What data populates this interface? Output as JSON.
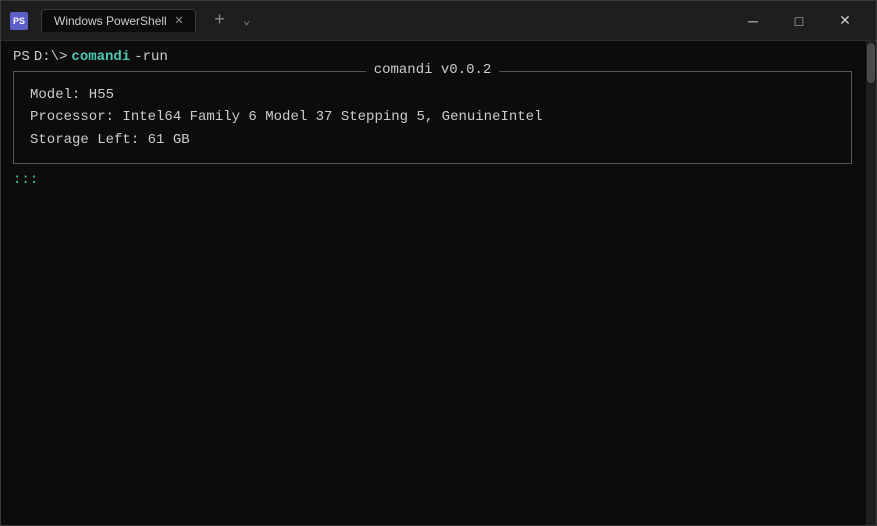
{
  "window": {
    "title": "Windows PowerShell",
    "icon_label": "PS"
  },
  "titlebar": {
    "tab_title": "Windows PowerShell",
    "new_tab_icon": "+",
    "dropdown_icon": "⌄",
    "minimize_icon": "─",
    "maximize_icon": "□",
    "close_icon": "✕"
  },
  "terminal": {
    "prompt_ps": "PS",
    "prompt_path": "D:\\>",
    "command": "comandi",
    "args": "-run",
    "box_title": "comandi v0.0.2",
    "model_label": "Model: H55",
    "processor_label": "Processor: Intel64 Family 6 Model 37 Stepping 5, GenuineIntel",
    "storage_label": "Storage Left: 61 GB",
    "cursor_symbol": ":::"
  }
}
